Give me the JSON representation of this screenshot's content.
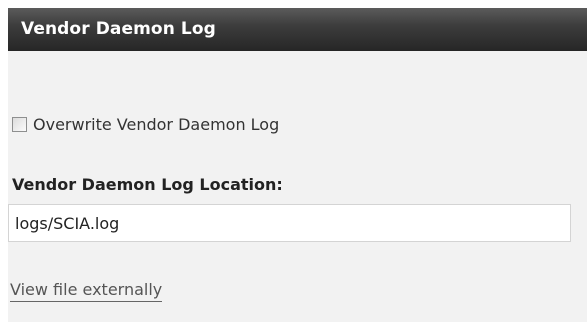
{
  "panel": {
    "title": "Vendor Daemon Log"
  },
  "overwrite_checkbox": {
    "label": "Overwrite Vendor Daemon Log",
    "checked": false
  },
  "log_location": {
    "label": "Vendor Daemon Log Location:",
    "value": "logs/SCIA.log"
  },
  "view_link": {
    "label": "View file externally"
  }
}
